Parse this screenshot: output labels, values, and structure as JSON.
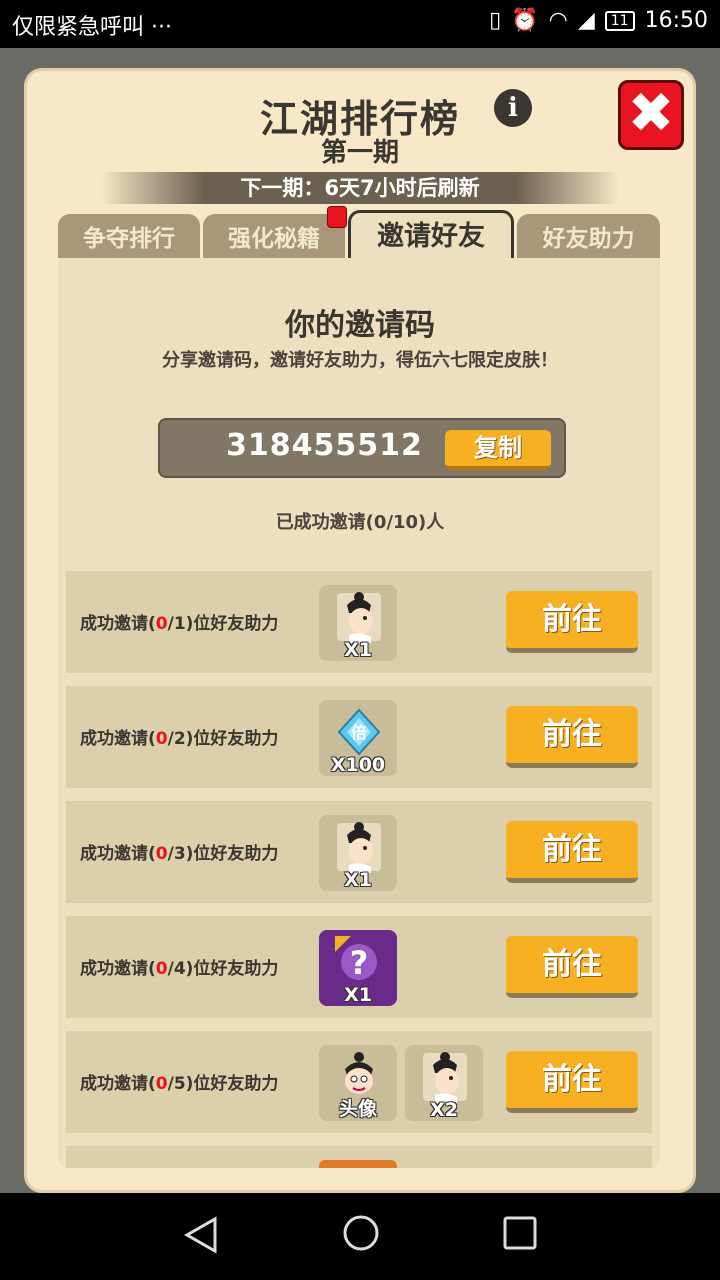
{
  "status_bar": {
    "left_text": "仅限紧急呼叫 ···",
    "battery": "11",
    "time": "16:50"
  },
  "dialog": {
    "title": "江湖排行榜",
    "subtitle": "第一期",
    "refresh_text": "下一期：6天7小时后刷新",
    "tabs": [
      {
        "label": "争夺排行",
        "active": false
      },
      {
        "label": "强化秘籍",
        "active": false
      },
      {
        "label": "邀请好友",
        "active": true
      },
      {
        "label": "好友助力",
        "active": false
      }
    ]
  },
  "invite": {
    "heading": "你的邀请码",
    "description": "分享邀请码，邀请好友助力，得伍六七限定皮肤！",
    "code": "318455512",
    "copy_label": "复制",
    "status": "已成功邀请(0/10)人"
  },
  "rows": [
    {
      "prefix": "成功邀请(",
      "done": "0",
      "total": "/1)位好友助力",
      "rewards": [
        {
          "type": "fragment",
          "qty": "X1"
        }
      ],
      "button": "前往"
    },
    {
      "prefix": "成功邀请(",
      "done": "0",
      "total": "/2)位好友助力",
      "rewards": [
        {
          "type": "gem",
          "qty": "X100"
        }
      ],
      "button": "前往"
    },
    {
      "prefix": "成功邀请(",
      "done": "0",
      "total": "/3)位好友助力",
      "rewards": [
        {
          "type": "fragment",
          "qty": "X1"
        }
      ],
      "button": "前往"
    },
    {
      "prefix": "成功邀请(",
      "done": "0",
      "total": "/4)位好友助力",
      "rewards": [
        {
          "type": "mystery",
          "qty": "X1"
        }
      ],
      "button": "前往"
    },
    {
      "prefix": "成功邀请(",
      "done": "0",
      "total": "/5)位好友助力",
      "rewards": [
        {
          "type": "avatar",
          "qty": "头像"
        },
        {
          "type": "fragment",
          "qty": "X2"
        }
      ],
      "button": "前往"
    }
  ],
  "gem_glyph": "倍",
  "mystery_glyph": "?",
  "colors": {
    "panel": "#f7e8c8",
    "accent": "#f6b022",
    "highlight": "#e8141f",
    "text": "#3a3630"
  }
}
